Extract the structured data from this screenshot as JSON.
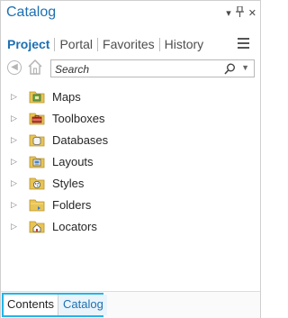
{
  "pane": {
    "title": "Catalog",
    "controls": [
      "dropdown-icon",
      "pin-icon",
      "close-icon"
    ]
  },
  "tabs": [
    {
      "label": "Project",
      "active": true
    },
    {
      "label": "Portal",
      "active": false
    },
    {
      "label": "Favorites",
      "active": false
    },
    {
      "label": "History",
      "active": false
    }
  ],
  "search": {
    "placeholder": "Search"
  },
  "tree": [
    {
      "label": "Maps",
      "icon": "maps-folder-icon"
    },
    {
      "label": "Toolboxes",
      "icon": "toolbox-folder-icon"
    },
    {
      "label": "Databases",
      "icon": "database-folder-icon"
    },
    {
      "label": "Layouts",
      "icon": "layout-folder-icon"
    },
    {
      "label": "Styles",
      "icon": "style-folder-icon"
    },
    {
      "label": "Folders",
      "icon": "folder-icon"
    },
    {
      "label": "Locators",
      "icon": "locator-folder-icon"
    }
  ],
  "bottom_tabs": [
    {
      "label": "Contents",
      "active": false
    },
    {
      "label": "Catalog",
      "active": true
    }
  ],
  "colors": {
    "accent": "#1d6fb1",
    "highlight_border": "#22b5e8",
    "folder_yellow": "#e8c453"
  }
}
